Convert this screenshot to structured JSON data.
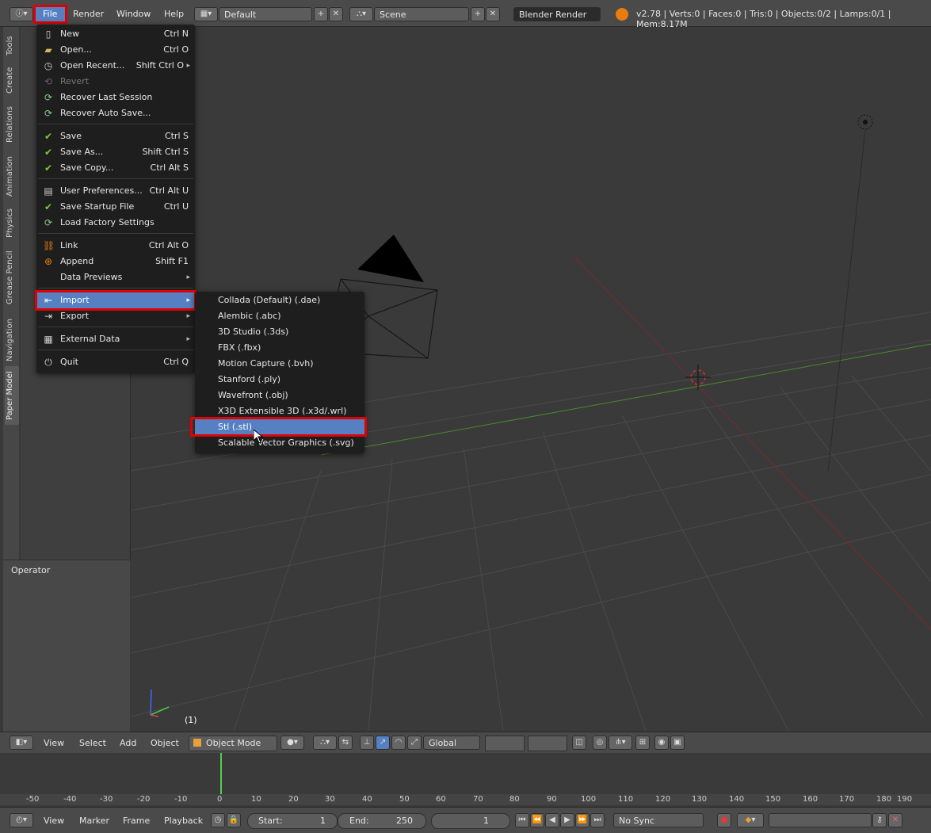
{
  "topbar": {
    "menus": [
      "File",
      "Render",
      "Window",
      "Help"
    ],
    "layout": "Default",
    "scene": "Scene",
    "engine": "Blender Render",
    "stats": "v2.78 | Verts:0 | Faces:0 | Tris:0 | Objects:0/2 | Lamps:0/1 | Mem:8.17M"
  },
  "tool_tabs": [
    "Tools",
    "Create",
    "Relations",
    "Animation",
    "Physics",
    "Grease Pencil",
    "Navigation",
    "Paper Model"
  ],
  "operator": {
    "title": "Operator"
  },
  "file_menu": {
    "items": [
      {
        "label": "New",
        "shortcut": "Ctrl N"
      },
      {
        "label": "Open...",
        "shortcut": "Ctrl O"
      },
      {
        "label": "Open Recent...",
        "shortcut": "Shift Ctrl O"
      },
      {
        "label": "Revert",
        "shortcut": ""
      },
      {
        "label": "Recover Last Session",
        "shortcut": ""
      },
      {
        "label": "Recover Auto Save...",
        "shortcut": ""
      },
      {
        "label": "Save",
        "shortcut": "Ctrl S"
      },
      {
        "label": "Save As...",
        "shortcut": "Shift Ctrl S"
      },
      {
        "label": "Save Copy...",
        "shortcut": "Ctrl Alt S"
      },
      {
        "label": "User Preferences...",
        "shortcut": "Ctrl Alt U"
      },
      {
        "label": "Save Startup File",
        "shortcut": "Ctrl U"
      },
      {
        "label": "Load Factory Settings",
        "shortcut": ""
      },
      {
        "label": "Link",
        "shortcut": "Ctrl Alt O"
      },
      {
        "label": "Append",
        "shortcut": "Shift F1"
      },
      {
        "label": "Data Previews",
        "shortcut": ""
      },
      {
        "label": "Import",
        "shortcut": ""
      },
      {
        "label": "Export",
        "shortcut": ""
      },
      {
        "label": "External Data",
        "shortcut": ""
      },
      {
        "label": "Quit",
        "shortcut": "Ctrl Q"
      }
    ]
  },
  "import_menu": {
    "items": [
      "Collada (Default) (.dae)",
      "Alembic (.abc)",
      "3D Studio (.3ds)",
      "FBX (.fbx)",
      "Motion Capture (.bvh)",
      "Stanford (.ply)",
      "Wavefront (.obj)",
      "X3D Extensible 3D (.x3d/.wrl)",
      "Stl (.stl)",
      "Scalable Vector Graphics (.svg)"
    ]
  },
  "viewport": {
    "frame_label": "(1)"
  },
  "view_header": {
    "menus": [
      "View",
      "Select",
      "Add",
      "Object"
    ],
    "mode": "Object Mode",
    "orientation": "Global"
  },
  "timeline": {
    "ruler": [
      "-50",
      "-40",
      "-30",
      "-20",
      "-10",
      "0",
      "10",
      "20",
      "30",
      "40",
      "50",
      "60",
      "70",
      "80",
      "90",
      "100",
      "110",
      "120",
      "130",
      "140",
      "150",
      "160",
      "170",
      "180",
      "190"
    ]
  },
  "tl_header": {
    "menus": [
      "View",
      "Marker",
      "Frame",
      "Playback"
    ],
    "start_label": "Start:",
    "start_value": "1",
    "end_label": "End:",
    "end_value": "250",
    "current_frame": "1",
    "sync": "No Sync"
  }
}
